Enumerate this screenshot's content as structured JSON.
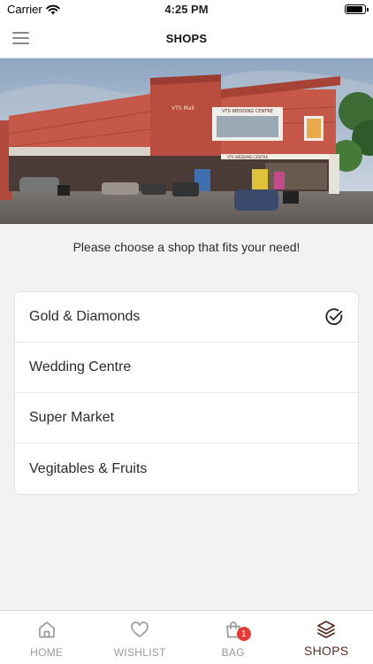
{
  "status_bar": {
    "carrier": "Carrier",
    "time": "4:25 PM"
  },
  "nav": {
    "title": "SHOPS"
  },
  "banner": {
    "signs": [
      "VTS Mall",
      "VTS WEDDING CENTRE",
      "VTS WEDDING CENTRE"
    ]
  },
  "prompt": "Please choose a shop that fits your need!",
  "shops": [
    {
      "label": "Gold & Diamonds",
      "selected": true
    },
    {
      "label": "Wedding Centre",
      "selected": false
    },
    {
      "label": "Super Market",
      "selected": false
    },
    {
      "label": "Vegitables & Fruits",
      "selected": false
    }
  ],
  "tabs": [
    {
      "label": "HOME",
      "icon": "home-icon",
      "active": false
    },
    {
      "label": "WISHLIST",
      "icon": "heart-icon",
      "active": false
    },
    {
      "label": "BAG",
      "icon": "bag-icon",
      "active": false,
      "badge": "1"
    },
    {
      "label": "SHOPS",
      "icon": "layers-icon",
      "active": true
    }
  ],
  "colors": {
    "accent": "#5a2b1f",
    "badge": "#e53935",
    "building": "#c6584a"
  }
}
